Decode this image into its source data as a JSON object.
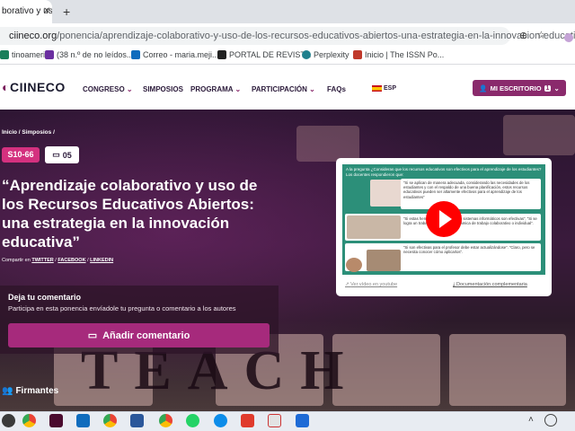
{
  "browser": {
    "tab_title": "borativo y us",
    "url_host": "ciineco.org",
    "url_path": "/ponencia/aprendizaje-colaborativo-y-uso-de-los-recursos-educativos-abiertos-una-estrategia-en-la-innovacion-educativa/",
    "bookmarks": [
      {
        "label": "tinoameri...",
        "color": "#1a7f5a"
      },
      {
        "label": "(38 n.º de no leídos...",
        "color": "#6b2fa0"
      },
      {
        "label": "Correo - maria.meji...",
        "color": "#0f6cbd"
      },
      {
        "label": "PORTAL DE REVIST...",
        "color": "#222222"
      },
      {
        "label": "Perplexity",
        "color": "#20808d"
      },
      {
        "label": "Inicio | The ISSN Po...",
        "color": "#c0392b"
      }
    ]
  },
  "site": {
    "logo": "CIINECO",
    "nav": [
      "CONGRESO",
      "SIMPOSIOS",
      "PROGRAMA",
      "PARTICIPACIÓN",
      "FAQs"
    ],
    "lang": "ESP",
    "desk_label": "MI ESCRITORIO",
    "desk_badge": "1"
  },
  "hero": {
    "breadcrumb": "Inicio / Simposios /",
    "code": "S10-66",
    "comment_count": "05",
    "title": "“Aprendizaje colaborativo y uso de los Recursos Educativos Abiertos: una estrategia en la innovación educativa”",
    "share_prefix": "Compartir en",
    "share_links": [
      "TWITTER",
      "FACEBOOK",
      "LINKEDIN"
    ],
    "comment_heading": "Deja tu comentario",
    "comment_sub": "Participa en esta ponencia envíadole tu pregunta o comentario a los autores",
    "add_comment": "Añadir comentario",
    "signers": "Firmantes",
    "bg_word": "TEACH"
  },
  "video": {
    "slide_top": "A la pregunta ¿Consideras que los recursos educativos son efectivos para el aprendizaje de los estudiantes? Los docentes respondieron que:",
    "quote1": "“Si se aplican de manera adecuada, considerando las necesidades de los estudiantes y con el respaldo de una buena planificación, estos recursos educativos pueden ser altamente efectivos para el aprendizaje de los estudiantes”",
    "quote2": "“Si estas herramientas se usan en sistemas informáticos son efectivas”, “Si se logra un trabajo efectivo en la dinámica de trabajo colaborativo o individual”.",
    "quote3": "“Si son efectivas para el profesor debe estar actualizándose”. “Claro, pero se necesita conocer cómo aplicarlos”.",
    "youtube_link": "Ver vídeo en youtube",
    "doc_link": "Documentación complementaria"
  },
  "colors": {
    "brand": "#8a2a6c",
    "accent": "#d4317f",
    "button": "#a62a7c",
    "slide": "#2c8f79"
  }
}
